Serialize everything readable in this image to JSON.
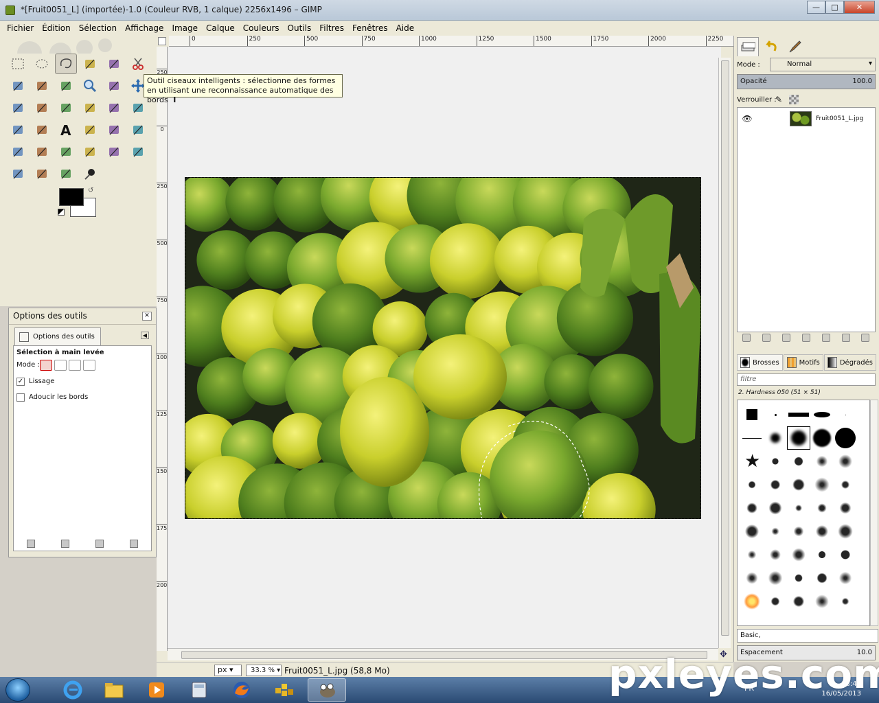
{
  "window": {
    "title": "*[Fruit0051_L] (importée)-1.0 (Couleur RVB, 1 calque) 2256x1496 – GIMP"
  },
  "menu": [
    "Fichier",
    "Édition",
    "Sélection",
    "Affichage",
    "Image",
    "Calque",
    "Couleurs",
    "Outils",
    "Filtres",
    "Fenêtres",
    "Aide"
  ],
  "toolbox": {
    "tools": [
      {
        "name": "rect-select-icon",
        "active": false
      },
      {
        "name": "ellipse-select-icon",
        "active": false
      },
      {
        "name": "free-select-icon",
        "active": true
      },
      {
        "name": "fuzzy-select-icon",
        "active": false
      },
      {
        "name": "select-by-color-icon",
        "active": false
      },
      {
        "name": "scissors-select-icon",
        "active": false
      },
      {
        "name": "foreground-select-icon",
        "active": false
      },
      {
        "name": "paths-icon",
        "active": false
      },
      {
        "name": "color-picker-icon",
        "active": false
      },
      {
        "name": "zoom-icon",
        "active": false
      },
      {
        "name": "measure-icon",
        "active": false
      },
      {
        "name": "move-icon",
        "active": false
      },
      {
        "name": "align-icon",
        "active": false
      },
      {
        "name": "crop-icon",
        "active": false
      },
      {
        "name": "rotate-icon",
        "active": false
      },
      {
        "name": "scale-icon",
        "active": false
      },
      {
        "name": "shear-icon",
        "active": false
      },
      {
        "name": "perspective-icon",
        "active": false
      },
      {
        "name": "flip-icon",
        "active": false
      },
      {
        "name": "cage-icon",
        "active": false
      },
      {
        "name": "text-icon",
        "active": false
      },
      {
        "name": "bucket-fill-icon",
        "active": false
      },
      {
        "name": "gradient-icon",
        "active": false
      },
      {
        "name": "pencil-icon",
        "active": false
      },
      {
        "name": "paintbrush-icon",
        "active": false
      },
      {
        "name": "eraser-icon",
        "active": false
      },
      {
        "name": "airbrush-icon",
        "active": false
      },
      {
        "name": "ink-icon",
        "active": false
      },
      {
        "name": "clone-icon",
        "active": false
      },
      {
        "name": "heal-icon",
        "active": false
      },
      {
        "name": "perspective-clone-icon",
        "active": false
      },
      {
        "name": "blur-icon",
        "active": false
      },
      {
        "name": "smudge-icon",
        "active": false
      },
      {
        "name": "dodge-burn-icon",
        "active": false
      }
    ],
    "tooltip": "Outil ciseaux intelligents : sélectionne des formes en utilisant une reconnaissance automatique des bords",
    "tooltip_shortcut": "I"
  },
  "tool_options": {
    "title": "Options des outils",
    "tab_label": "Options des outils",
    "tool_name": "Sélection à main levée",
    "mode_label": "Mode :",
    "antialias": {
      "label": "Lissage",
      "checked": true
    },
    "feather": {
      "label": "Adoucir les bords",
      "checked": false
    }
  },
  "rulers": {
    "h": [
      "0",
      "250",
      "500",
      "750",
      "1000",
      "1250",
      "1500",
      "1750",
      "2000",
      "2250"
    ],
    "v": [
      "250",
      "0",
      "250",
      "500",
      "750",
      "1000",
      "1250",
      "1500",
      "1750",
      "2000"
    ]
  },
  "status": {
    "unit": "px",
    "zoom": "33.3 %",
    "file_info": "Fruit0051_L.jpg (58,8 Mo)"
  },
  "layers": {
    "mode_label": "Mode :",
    "mode_value": "Normal",
    "opacity_label": "Opacité",
    "opacity_value": "100.0",
    "lock_label": "Verrouiller :",
    "layer_name": "Fruit0051_L.jpg"
  },
  "brushes": {
    "tabs": [
      "Brosses",
      "Motifs",
      "Dégradés"
    ],
    "filter_placeholder": "filtre",
    "selected_brush": "2. Hardness 050 (51 × 51)",
    "preset": "Basic,",
    "spacing_label": "Espacement",
    "spacing_value": "10.0"
  },
  "taskbar": {
    "lang": "FR",
    "time": "18:40",
    "date": "16/05/2013"
  },
  "watermark": "pxleyes.com"
}
